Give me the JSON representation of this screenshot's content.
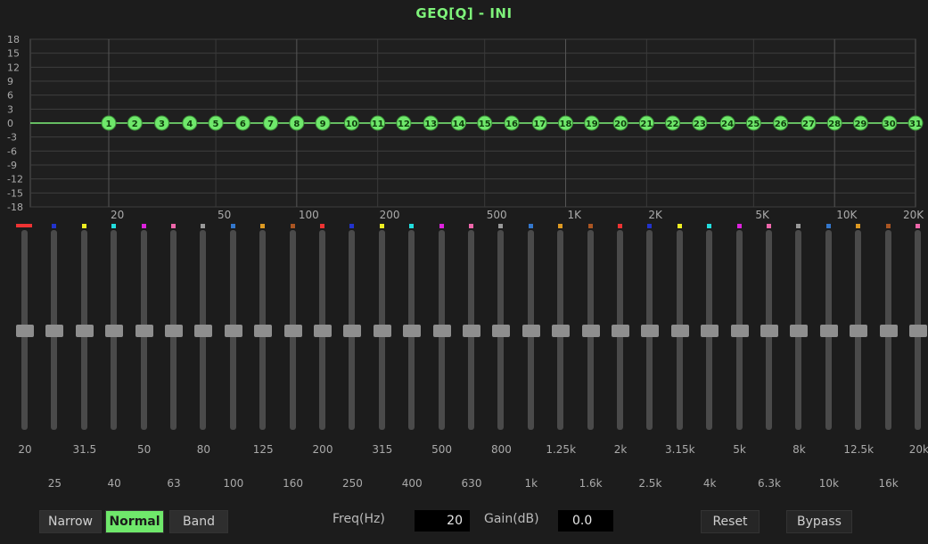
{
  "title": "GEQ[Q] - INI",
  "graph": {
    "y_ticks": [
      "18",
      "15",
      "12",
      "9",
      "6",
      "3",
      "0",
      "-3",
      "-6",
      "-9",
      "-12",
      "-15",
      "-18"
    ],
    "x_labels": [
      "20",
      "50",
      "100",
      "200",
      "500",
      "1K",
      "2K",
      "5K",
      "10K",
      "20K"
    ],
    "curve_color": "#7ef27a",
    "bands": [
      "1",
      "2",
      "3",
      "4",
      "5",
      "6",
      "7",
      "8",
      "9",
      "10",
      "11",
      "12",
      "13",
      "14",
      "15",
      "16",
      "17",
      "18",
      "19",
      "20",
      "21",
      "22",
      "23",
      "24",
      "25",
      "26",
      "27",
      "28",
      "29",
      "30",
      "31"
    ]
  },
  "sliders": {
    "frequencies": [
      "20",
      "25",
      "31.5",
      "40",
      "50",
      "63",
      "80",
      "100",
      "125",
      "160",
      "200",
      "250",
      "315",
      "400",
      "500",
      "630",
      "800",
      "1k",
      "1.25k",
      "1.6k",
      "2k",
      "2.5k",
      "3.15k",
      "4k",
      "5k",
      "6.3k",
      "8k",
      "10k",
      "12.5k",
      "16k",
      "20k"
    ],
    "gains": [
      0,
      0,
      0,
      0,
      0,
      0,
      0,
      0,
      0,
      0,
      0,
      0,
      0,
      0,
      0,
      0,
      0,
      0,
      0,
      0,
      0,
      0,
      0,
      0,
      0,
      0,
      0,
      0,
      0,
      0,
      0
    ],
    "dot_colors": [
      "#e33",
      "#23c",
      "#ee2",
      "#2dd",
      "#d2d",
      "#e6a",
      "#999",
      "#37c",
      "#d92",
      "#a52",
      "#e33",
      "#23c",
      "#ee2",
      "#2dd",
      "#d2d",
      "#e6a",
      "#999",
      "#37c",
      "#d92",
      "#a52",
      "#e33",
      "#23c",
      "#ee2",
      "#2dd",
      "#d2d",
      "#e6a",
      "#999",
      "#37c",
      "#d92",
      "#a52",
      "#e6a"
    ]
  },
  "controls": {
    "narrow": "Narrow",
    "normal": "Normal",
    "band": "Band",
    "freq_label": "Freq(Hz)",
    "freq_value": "20",
    "gain_label": "Gain(dB)",
    "gain_value": "0.0",
    "reset": "Reset",
    "bypass": "Bypass"
  }
}
